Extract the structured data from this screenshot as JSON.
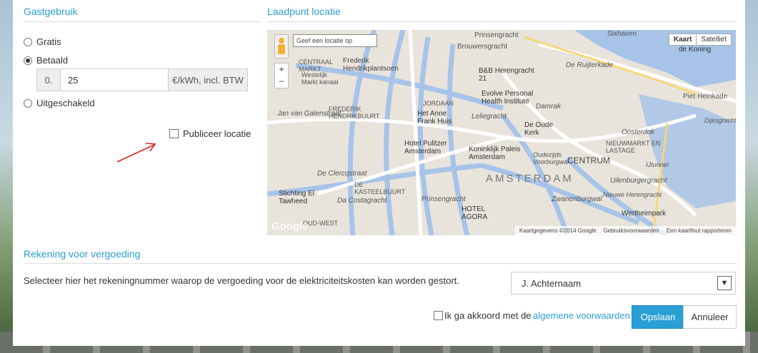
{
  "guest": {
    "title": "Gastgebruik",
    "options": [
      "Gratis",
      "Betaald",
      "Uitgeschakeld"
    ],
    "selected": "Betaald",
    "price_prefix": "0.",
    "price_value": "25",
    "price_unit": "€/kWh, incl. BTW",
    "publish_label": "Publiceer locatie"
  },
  "location": {
    "title": "Laadpunt locatie",
    "map": {
      "search_placeholder": "Geef een locatie op",
      "type_map": "Kaart",
      "type_satellite": "Satelliet",
      "zoom_in": "+",
      "zoom_out": "–",
      "watermark": "Google",
      "footer_data": "Kaartgegevens ©2014 Google",
      "footer_terms": "Gebruiksvoorwaarden",
      "footer_report": "Een kaartfout rapporteren",
      "labels": [
        "Prinsengracht",
        "Sixhaven",
        "de Koning",
        "Brouwersgracht",
        "Frederik Hendrikplantsoen",
        "CENTRAAL MARKT",
        "Westelijk Markt kanaal",
        "B&B Herengracht 21",
        "De Ruijterkade",
        "Piet Heinkade",
        "JORDAAN",
        "Evolve Personal Health Institute",
        "Damrak",
        "Jan van Galenstraat",
        "FREDERIK HENDRIKBUURT",
        "Het Anne Frank Huis",
        "Leliegracht",
        "De Oude Kerk",
        "Oosterdok",
        "Hotel Pulitzer Amsterdam",
        "Koninklijk Paleis Amsterdam",
        "CENTRUM",
        "NIEUWMARKT EN LASTAGE",
        "De Clercqstraat",
        "AMSTERDAM",
        "Oudezijds Voorburgwal",
        "Stichting El Tawheed",
        "DE KASTEELBUURT",
        "Da Costagracht",
        "Prinsengracht",
        "HOTEL AGORA",
        "Zwanenburgwal",
        "Nieuwe Herengracht",
        "Wertheimpark",
        "OUD-WEST",
        "Uilenburgergracht",
        "IJtunnel",
        "Dijksgracht"
      ]
    }
  },
  "billing": {
    "title": "Rekening voor vergoeding",
    "description": "Selecteer hier het rekeningnummer waarop de vergoeding voor de elektriciteitskosten kan worden gestort.",
    "account": "J. Achternaam"
  },
  "footer": {
    "agree_prefix": "Ik ga akkoord met de",
    "agree_link": "algemene voorwaarden",
    "save": "Opslaan",
    "cancel": "Annuleer"
  },
  "colors": {
    "accent": "#2a9fd6",
    "arrow": "#d22"
  }
}
